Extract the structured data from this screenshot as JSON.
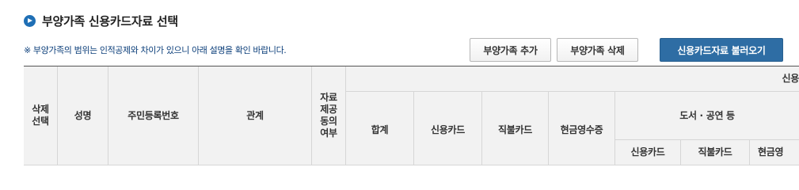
{
  "section": {
    "title": "부양가족 신용카드자료 선택"
  },
  "notice": "※ 부양가족의 범위는 인적공제와 차이가 있으니 아래 설명을 확인 바랍니다.",
  "buttons": {
    "add": "부양가족 추가",
    "delete": "부양가족 삭제",
    "load": "신용카드자료 불러오기"
  },
  "table": {
    "headers": {
      "delete_select": "삭제\n선택",
      "name": "성명",
      "resident_number": "주민등록번호",
      "relation": "관계",
      "data_provision": "자료\n제공\n동의\n여부",
      "credit_card_group": "신용",
      "total": "합계",
      "credit_card": "신용카드",
      "debit_card": "직불카드",
      "cash_receipt": "현금영수증",
      "books_performance": "도서 · 공연 등",
      "sub_credit_card": "신용카드",
      "sub_debit_card": "직불카드",
      "sub_cash_receipt": "현금영"
    }
  },
  "colors": {
    "accent": "#1f6fb5",
    "primary_button": "#2e6da4",
    "notice_text": "#0b3e7a",
    "header_bg": "#f2f2f2"
  }
}
